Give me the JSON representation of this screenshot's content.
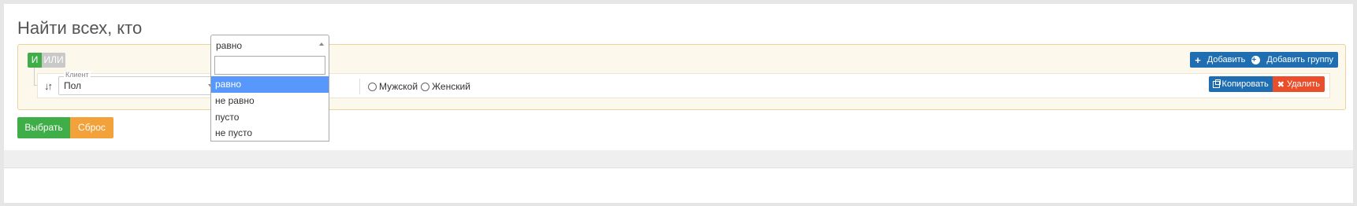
{
  "page": {
    "title": "Найти всех, кто"
  },
  "builder": {
    "conditions": {
      "and_label": "И",
      "or_label": "ИЛИ"
    },
    "group_actions": {
      "add_label": "Добавить",
      "add_group_label": "Добавить группу"
    },
    "rule": {
      "field_legend": "Клиент",
      "field_value": "Пол",
      "operator_value": "равно",
      "radio_options": [
        "Мужской",
        "Женский"
      ],
      "copy_label": "Копировать",
      "delete_label": "Удалить"
    },
    "operator_dropdown": {
      "search_value": "",
      "options": [
        "равно",
        "не равно",
        "пусто",
        "не пусто"
      ],
      "selected_index": 0
    }
  },
  "actions": {
    "select_label": "Выбрать",
    "reset_label": "Сброс"
  },
  "colors": {
    "and_active": "#3fae49",
    "primary": "#1f6eb2",
    "danger": "#ea4e2b",
    "warning": "#f2a13b",
    "dropdown_highlight": "#5897fb"
  },
  "icons": {
    "add": "plus-icon",
    "add_group": "plus-circle-icon",
    "sort": "sort-icon",
    "copy": "copy-icon",
    "delete": "x-icon"
  }
}
